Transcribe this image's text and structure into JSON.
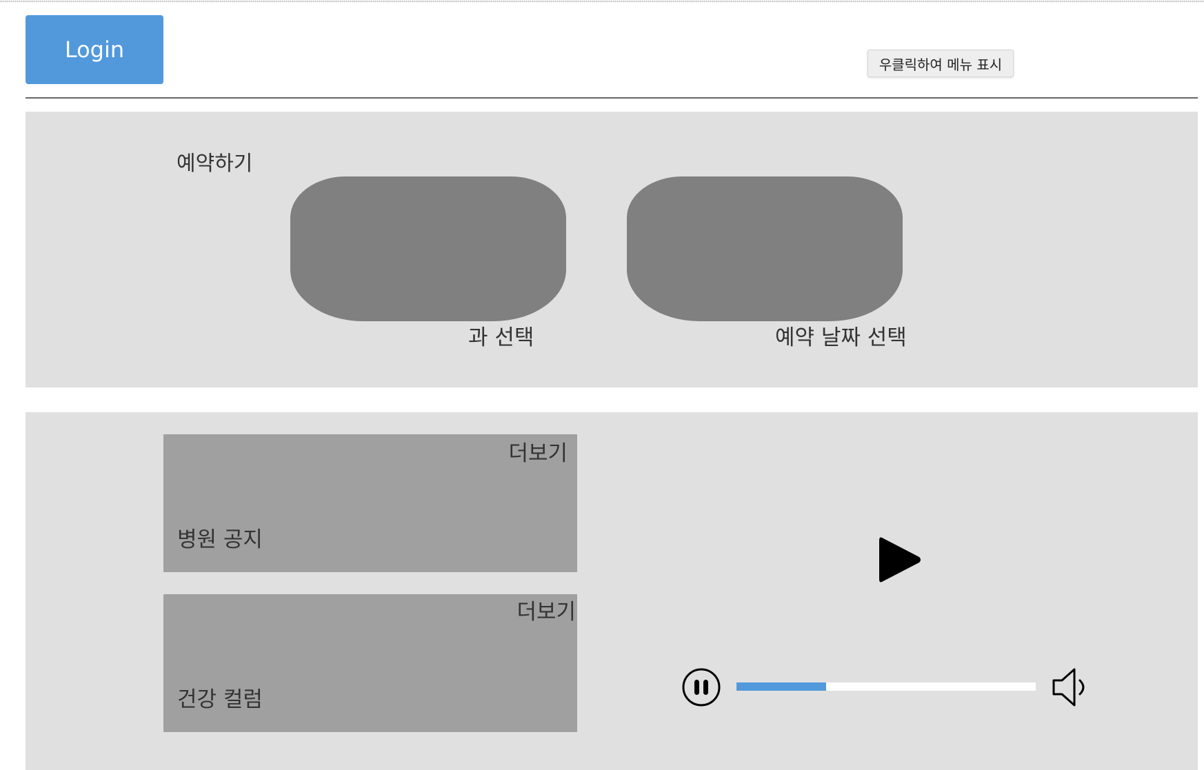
{
  "header": {
    "login_label": "Login",
    "context_hint": "우클릭하여 메뉴 표시"
  },
  "booking": {
    "title": "예약하기",
    "department_label": "과 선택",
    "date_label": "예약 날짜 선택"
  },
  "cards": {
    "notice": {
      "title": "병원 공지",
      "more_label": "더보기"
    },
    "column": {
      "title": "건강 컬럼",
      "more_label": "더보기"
    }
  },
  "media_player": {
    "play_icon": "play-icon",
    "pause_icon": "pause-icon",
    "volume_icon": "volume-icon",
    "progress_fraction": 0.3,
    "progress_color": "#5299dc"
  },
  "colors": {
    "accent": "#5299dc",
    "section_background": "#e0e0e0",
    "pill": "#808080",
    "card": "#a0a0a0"
  }
}
